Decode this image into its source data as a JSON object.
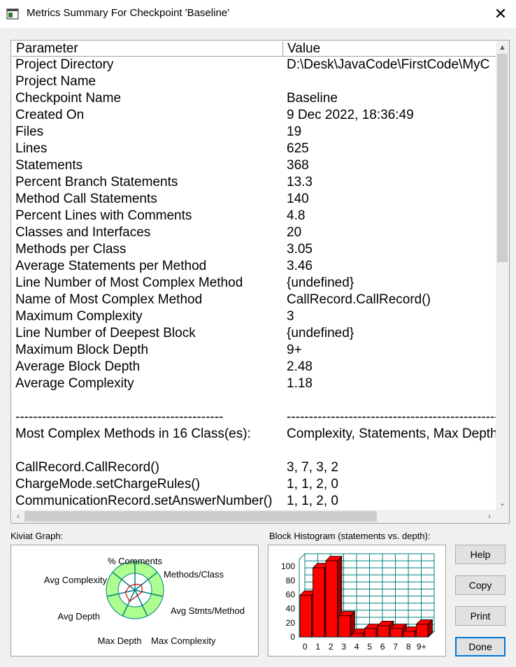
{
  "window": {
    "title": "Metrics Summary For Checkpoint 'Baseline'",
    "close_glyph": "✕"
  },
  "list": {
    "columns": [
      "Parameter",
      "Value"
    ],
    "rows": [
      [
        "Project Directory",
        "D:\\Desk\\JavaCode\\FirstCode\\MyC"
      ],
      [
        "Project Name",
        ""
      ],
      [
        "Checkpoint Name",
        "Baseline"
      ],
      [
        "Created On",
        "9 Dec 2022, 18:36:49"
      ],
      [
        "Files",
        "19"
      ],
      [
        "Lines",
        "625"
      ],
      [
        "Statements",
        "368"
      ],
      [
        "Percent Branch Statements",
        "13.3"
      ],
      [
        "Method Call Statements",
        "140"
      ],
      [
        "Percent Lines with Comments",
        "4.8"
      ],
      [
        "Classes and Interfaces",
        "20"
      ],
      [
        "Methods per Class",
        "3.05"
      ],
      [
        "Average Statements per Method",
        "3.46"
      ],
      [
        "Line Number of Most Complex Method",
        "{undefined}"
      ],
      [
        "Name of Most Complex Method",
        "CallRecord.CallRecord()"
      ],
      [
        "Maximum Complexity",
        "3"
      ],
      [
        "Line Number of Deepest Block",
        "{undefined}"
      ],
      [
        "Maximum Block Depth",
        "9+"
      ],
      [
        "Average Block Depth",
        "2.48"
      ],
      [
        "Average Complexity",
        "1.18"
      ],
      [
        "",
        ""
      ],
      [
        "-----------------------------------------------",
        "----------------------------------------------------------------"
      ],
      [
        "Most Complex Methods in 16 Class(es):",
        "Complexity, Statements, Max Depth, Calls"
      ],
      [
        "",
        ""
      ],
      [
        "CallRecord.CallRecord()",
        "3, 7, 3, 2"
      ],
      [
        "ChargeMode.setChargeRules()",
        "1, 1, 2, 0"
      ],
      [
        "CommunicationRecord.setAnswerNumber()",
        "1, 1, 2, 0"
      ]
    ]
  },
  "scroll": {
    "up": "▲",
    "down": "⌄",
    "left": "‹",
    "right": "›"
  },
  "kiviat": {
    "label": "Kiviat Graph:",
    "axes": [
      "% Comments",
      "Methods/Class",
      "Avg Stmts/Method",
      "Max Complexity",
      "Max Depth",
      "Avg Depth",
      "Avg Complexity"
    ],
    "colors": {
      "outer_ring": "#adff8f",
      "inner_ring": "#ffffff",
      "spokes": "#008080",
      "data_line": "#cc0000"
    }
  },
  "histogram": {
    "label": "Block Histogram (statements vs. depth):",
    "colors": {
      "bar": "#ff0000",
      "bar_dark": "#990000",
      "grid": "#008080"
    }
  },
  "chart_data": {
    "type": "bar",
    "categories": [
      "0",
      "1",
      "2",
      "3",
      "4",
      "5",
      "6",
      "7",
      "8",
      "9+"
    ],
    "values": [
      59,
      98,
      108,
      30,
      5,
      12,
      16,
      12,
      8,
      18
    ],
    "yticks": [
      0,
      20,
      40,
      60,
      80,
      100
    ],
    "ylim": [
      0,
      110
    ],
    "grid": true
  },
  "buttons": {
    "help": "Help",
    "copy": "Copy",
    "print": "Print",
    "done": "Done"
  }
}
